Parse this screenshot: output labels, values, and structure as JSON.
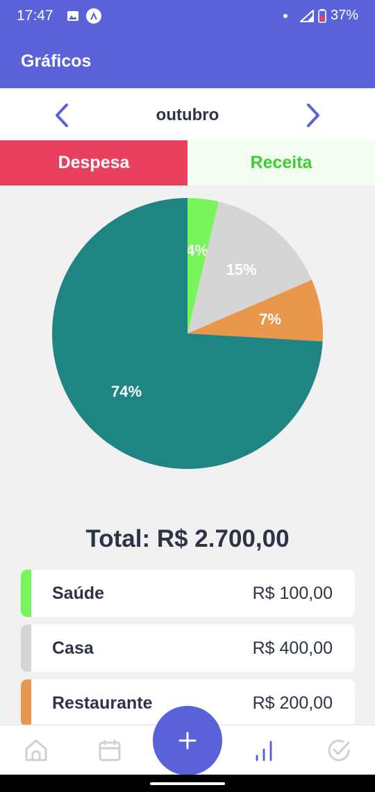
{
  "status_bar": {
    "time": "17:47",
    "battery": "37%"
  },
  "app": {
    "title": "Gráficos"
  },
  "month_nav": {
    "month": "outubro",
    "prev_icon": "chevron-left-icon",
    "next_icon": "chevron-right-icon"
  },
  "tabs": [
    {
      "label": "Despesa",
      "active": true,
      "color": "#e8405d"
    },
    {
      "label": "Receita",
      "active": false,
      "color": "#3bcf2d"
    }
  ],
  "chart_data": {
    "type": "pie",
    "title": "",
    "slices": [
      {
        "name": "Saúde",
        "value": 100,
        "percent_label": "4%",
        "color": "#77f55a"
      },
      {
        "name": "Casa",
        "value": 400,
        "percent_label": "15%",
        "color": "#d5d5d5"
      },
      {
        "name": "Restaurante",
        "value": 200,
        "percent_label": "7%",
        "color": "#e9974d"
      },
      {
        "name": "",
        "value": 2000,
        "percent_label": "74%",
        "color": "#1f8583"
      }
    ]
  },
  "total": {
    "text": "Total: R$ 2.700,00"
  },
  "categories": [
    {
      "name": "Saúde",
      "value": "R$ 100,00",
      "color": "#77f55a"
    },
    {
      "name": "Casa",
      "value": "R$ 400,00",
      "color": "#d5d5d5"
    },
    {
      "name": "Restaurante",
      "value": "R$ 200,00",
      "color": "#e9974d"
    }
  ],
  "bottom_nav": {
    "items": [
      "home-icon",
      "calendar-icon",
      "add-icon",
      "chart-icon",
      "check-circle-icon"
    ],
    "active": "chart-icon",
    "accent": "#5a62d9"
  }
}
